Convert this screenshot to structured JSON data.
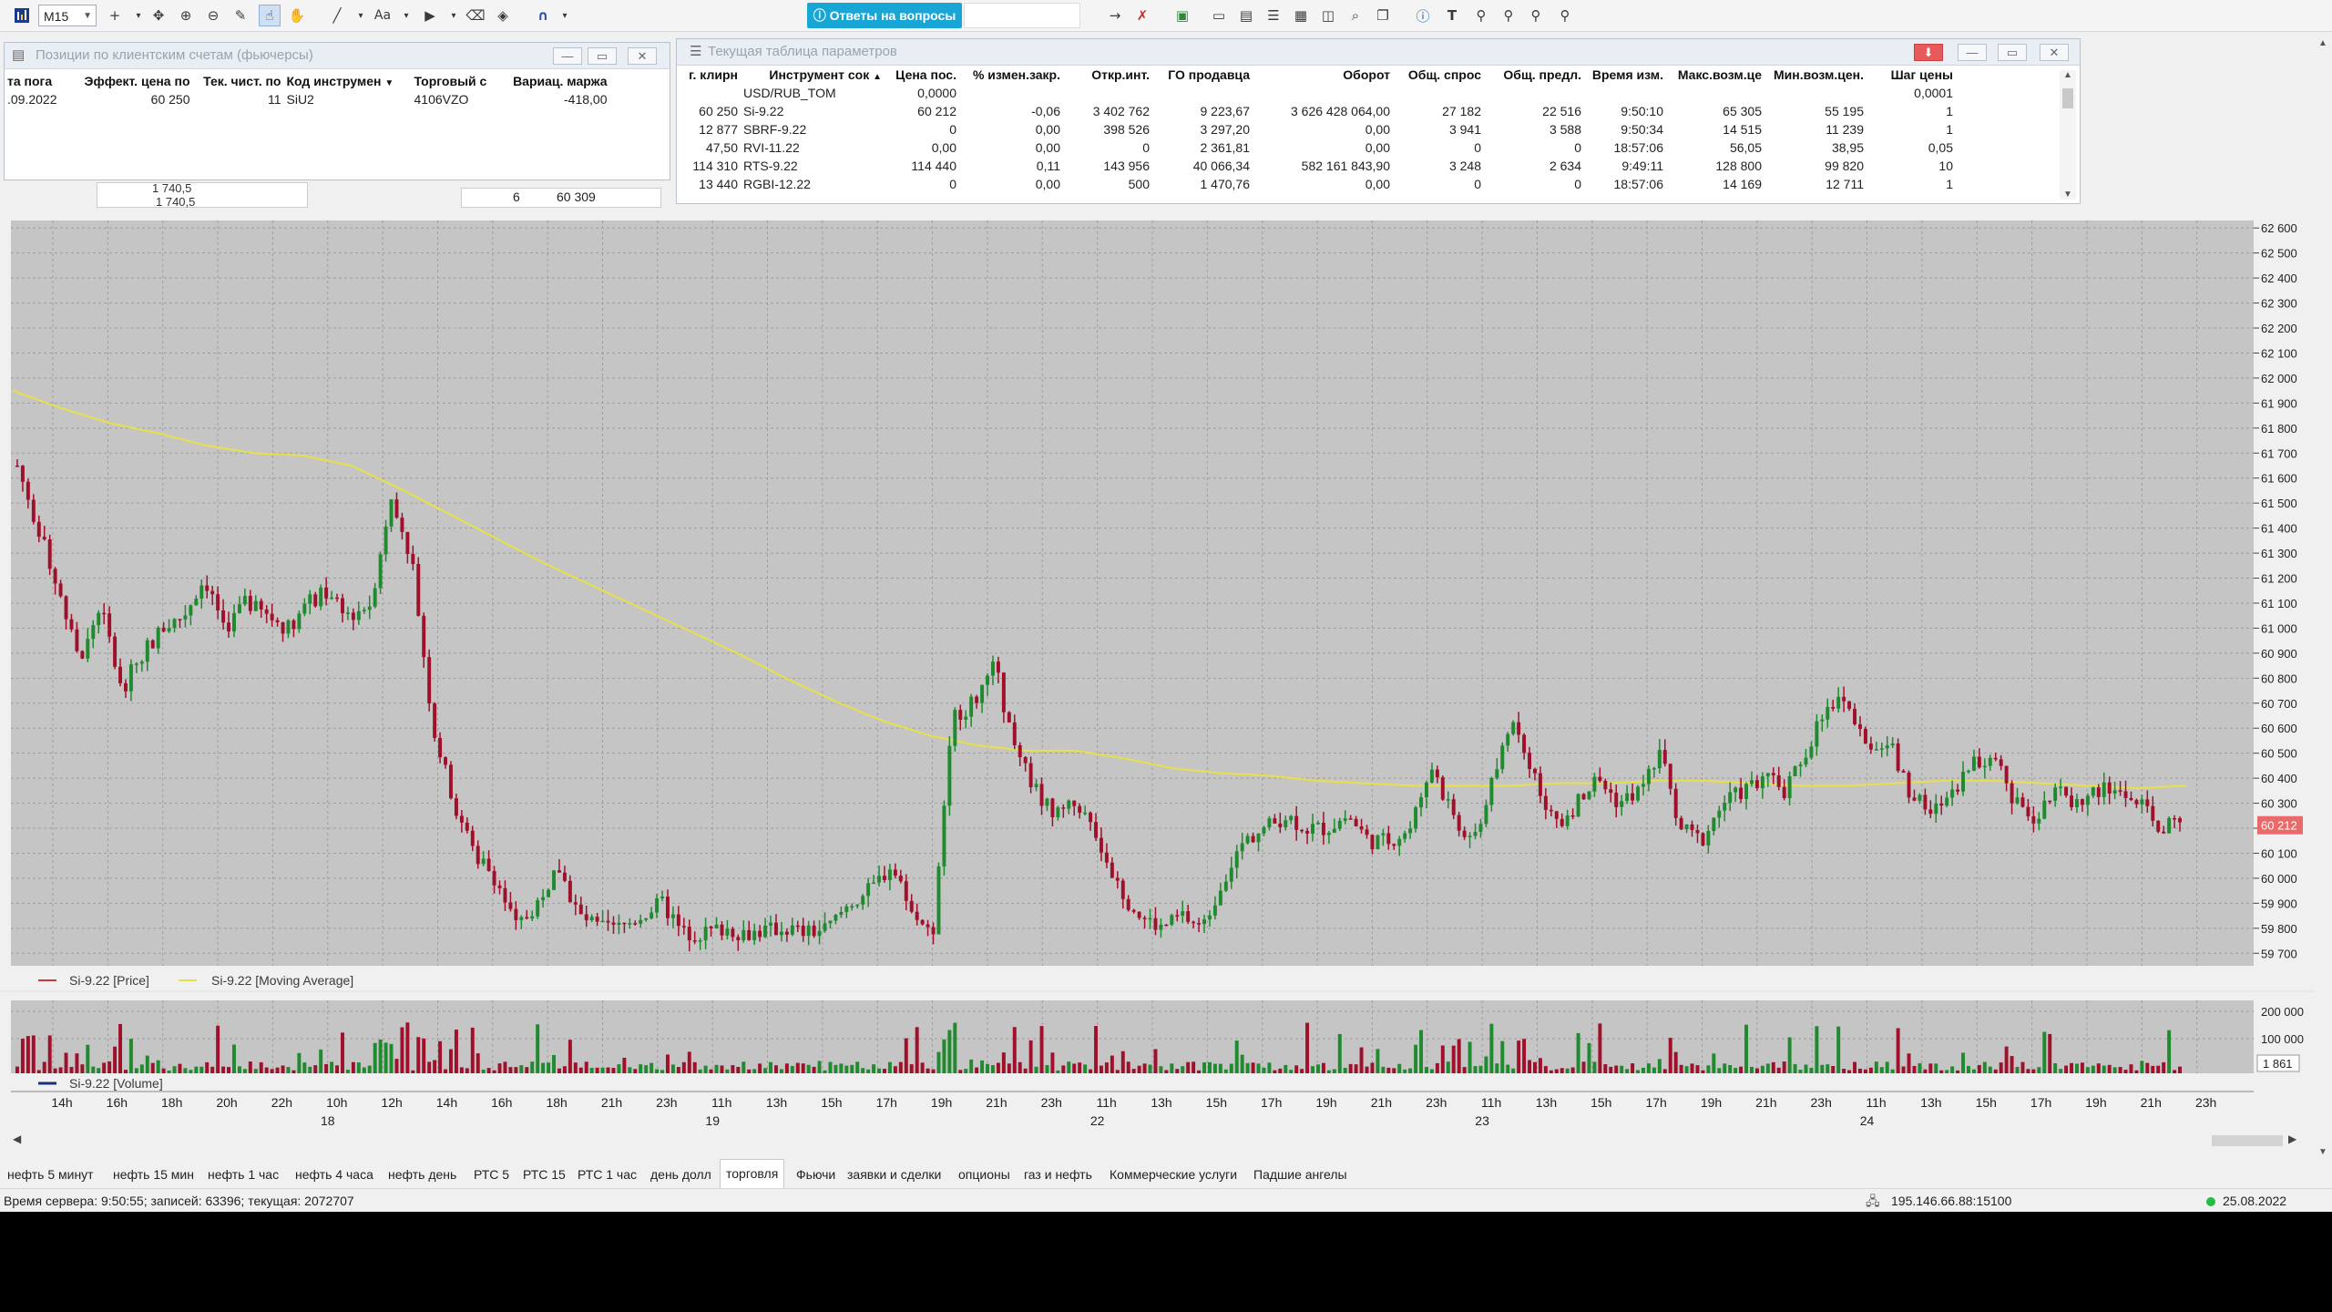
{
  "toolbar": {
    "timeframe": "M15",
    "answers_label": "Ответы на вопросы",
    "icons": [
      "chart-icon",
      "crosshair-icon",
      "move-icon",
      "zoom-in-icon",
      "zoom-out-icon",
      "ruler-icon",
      "pointer-hand-icon",
      "hand-icon",
      "line-tool-icon",
      "text-tool-icon",
      "arrow-tool-icon",
      "eraser-icon",
      "magnet-icon",
      "arrow-right-icon",
      "delete-icon",
      "save-icon",
      "window-icon",
      "table-icon",
      "list-icon",
      "grid-icon",
      "zoom-window-icon",
      "search-icon",
      "copy-icon",
      "info-icon",
      "text-icon",
      "tree-icon"
    ]
  },
  "positions_window": {
    "title": "Позиции по клиентским счетам (фьючерсы)",
    "columns": [
      "та пога",
      "Эффект. цена по",
      "Тек. чист. по",
      "Код инструмен",
      "Торговый с",
      "Вариац. маржа"
    ],
    "rows": [
      [
        ".09.2022",
        "60 250",
        "11",
        "SiU2",
        "4106VZO",
        "-418,00"
      ]
    ]
  },
  "params_window": {
    "title": "Текущая таблица параметров",
    "columns": [
      "г. клирн",
      "Инструмент сок",
      "Цена пос.",
      "% измен.закр.",
      "Откр.инт.",
      "ГО продавца",
      "Оборот",
      "Общ. спрос",
      "Общ. предл.",
      "Время изм.",
      "Макс.возм.це",
      "Мин.возм.цен.",
      "Шаг цены"
    ],
    "rows": [
      [
        "",
        "USD/RUB_TOM",
        "0,0000",
        "",
        "",
        "",
        "",
        "",
        "",
        "",
        "",
        "",
        "0,0001"
      ],
      [
        "60 250",
        "Si-9.22",
        "60 212",
        "-0,06",
        "3 402 762",
        "9 223,67",
        "3 626 428 064,00",
        "27 182",
        "22 516",
        "9:50:10",
        "65 305",
        "55 195",
        "1"
      ],
      [
        "12 877",
        "SBRF-9.22",
        "0",
        "0,00",
        "398 526",
        "3 297,20",
        "0,00",
        "3 941",
        "3 588",
        "9:50:34",
        "14 515",
        "11 239",
        "1"
      ],
      [
        "47,50",
        "RVI-11.22",
        "0,00",
        "0,00",
        "0",
        "2 361,81",
        "0,00",
        "0",
        "0",
        "18:57:06",
        "56,05",
        "38,95",
        "0,05"
      ],
      [
        "114 310",
        "RTS-9.22",
        "114 440",
        "0,11",
        "143 956",
        "40 066,34",
        "582 161 843,90",
        "3 248",
        "2 634",
        "9:49:11",
        "128 800",
        "99 820",
        "10"
      ],
      [
        "13 440",
        "RGBI-12.22",
        "0",
        "0,00",
        "500",
        "1 470,76",
        "0,00",
        "0",
        "0",
        "18:57:06",
        "14 169",
        "12 711",
        "1"
      ]
    ]
  },
  "behind_window": {
    "left_values": [
      "1 740,5",
      "1 740,5"
    ],
    "count": "6",
    "price": "60 309"
  },
  "chart_data": {
    "type": "candlestick",
    "instrument": "Si-9.22",
    "legend": [
      "Si-9.22 [Price]",
      "Si-9.22 [Moving Average]"
    ],
    "volume_legend": "Si-9.22 [Volume]",
    "price_ticks": [
      "62 600",
      "62 500",
      "62 400",
      "62 300",
      "62 200",
      "62 100",
      "62 000",
      "61 900",
      "61 800",
      "61 700",
      "61 600",
      "61 500",
      "61 400",
      "61 300",
      "61 200",
      "61 100",
      "61 000",
      "60 900",
      "60 800",
      "60 700",
      "60 600",
      "60 500",
      "60 400",
      "60 300",
      "60 200",
      "60 100",
      "60 000",
      "59 900",
      "59 800",
      "59 700"
    ],
    "ylim": [
      59650,
      62630
    ],
    "last_price": "60 212",
    "volume_ticks": [
      "200 000",
      "100 000"
    ],
    "last_volume": "1 861",
    "time_labels": [
      "14h",
      "16h",
      "18h",
      "20h",
      "22h",
      "10h",
      "12h",
      "14h",
      "16h",
      "18h",
      "21h",
      "23h",
      "11h",
      "13h",
      "15h",
      "17h",
      "19h",
      "21h",
      "23h",
      "11h",
      "13h",
      "15h",
      "17h",
      "19h",
      "21h",
      "23h",
      "11h",
      "13h",
      "15h",
      "17h",
      "19h",
      "21h",
      "23h",
      "11h",
      "13h",
      "15h",
      "17h",
      "19h",
      "21h",
      "23h"
    ],
    "day_labels": [
      "18",
      "19",
      "22",
      "23",
      "24"
    ],
    "price_path": [
      61650,
      61400,
      61150,
      60850,
      61100,
      60750,
      60900,
      61000,
      61050,
      61200,
      61000,
      61100,
      61050,
      61000,
      61100,
      61150,
      61050,
      61100,
      61550,
      61250,
      60600,
      60300,
      60100,
      60000,
      59800,
      59900,
      60050,
      59850,
      59800,
      59800,
      59850,
      59900,
      59780,
      59780,
      59800,
      59780,
      59790,
      59800,
      59780,
      59800,
      59900,
      59950,
      60050,
      59900,
      59750,
      60650,
      60700,
      60850,
      60500,
      60350,
      60250,
      60300,
      60150,
      59950,
      59850,
      59800,
      59850,
      59800,
      60000,
      60150,
      60200,
      60250,
      60200,
      60200,
      60250,
      60150,
      60150,
      60200,
      60450,
      60250,
      60150,
      60400,
      60650,
      60400,
      60200,
      60300,
      60400,
      60300,
      60350,
      60500,
      60200,
      60150,
      60300,
      60350,
      60400,
      60350,
      60500,
      60700,
      60700,
      60500,
      60550,
      60350,
      60250,
      60350,
      60450,
      60500,
      60300,
      60250,
      60350,
      60300,
      60350,
      60350,
      60300,
      60200,
      60212
    ],
    "moving_average": [
      61950,
      61880,
      61820,
      61780,
      61730,
      61700,
      61690,
      61650,
      61560,
      61460,
      61360,
      61260,
      61170,
      61080,
      60990,
      60900,
      60800,
      60710,
      60630,
      60570,
      60530,
      60510,
      60510,
      60480,
      60440,
      60420,
      60410,
      60390,
      60380,
      60370,
      60370,
      60370,
      60380,
      60380,
      60390,
      60390,
      60380,
      60370,
      60370,
      60380,
      60390,
      60390,
      60380,
      60370,
      60360,
      60370
    ],
    "colors": {
      "up": "#1f8a2e",
      "down": "#a0102a",
      "ma": "#e6e04a",
      "grid": "#a8a8a8",
      "bg": "#c5c5c5"
    }
  },
  "tabs": [
    "нефть 5 минут",
    "нефть 15 мин",
    "нефть 1 час",
    "нефть 4 часа",
    "нефть день",
    "РТС 5",
    "РТС 15",
    "РТС 1 час",
    "день долл",
    "торговля",
    "Фьючи",
    "заявки и сделки",
    "опционы",
    "газ и нефть",
    "Коммерческие услуги",
    "Падшие ангелы"
  ],
  "active_tab": "торговля",
  "status": {
    "left": "Время сервера: 9:50:55; записей: 63396; текущая: 2072707",
    "server": "195.146.66.88:15100",
    "date": "25.08.2022"
  }
}
